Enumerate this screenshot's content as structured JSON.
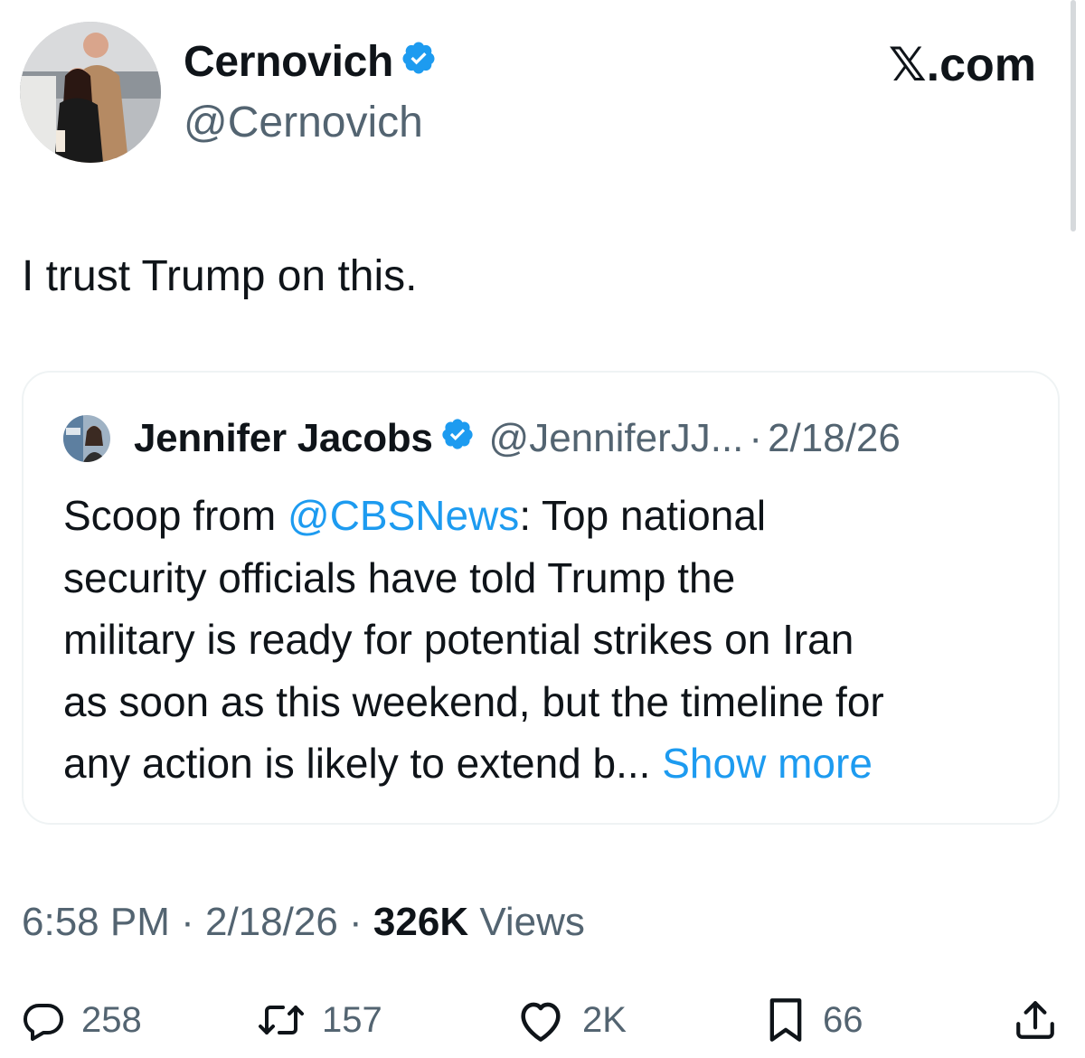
{
  "author": {
    "name": "Cernovich",
    "handle": "@Cernovich",
    "verified": true
  },
  "site": "𝕏.com",
  "tweet": {
    "text": "I trust Trump on this."
  },
  "quoted": {
    "name": "Jennifer Jacobs",
    "handle": "@JenniferJJ...",
    "separator": "·",
    "date": "2/18/26",
    "lines": [
      {
        "pre": "Scoop from ",
        "mention": "@CBSNews",
        "post": ": Top national"
      },
      "security officials have told Trump the",
      "military is ready for potential strikes on Iran",
      "as soon as this weekend, but the timeline for",
      {
        "pre": "any action is likely to extend b...",
        "link": " Show more"
      }
    ]
  },
  "meta": {
    "time": "6:58 PM",
    "sep": " · ",
    "date": "2/18/26",
    "views_count": "326K",
    "views_label": " Views"
  },
  "actions": {
    "replies": "258",
    "reposts": "157",
    "likes": "2K",
    "bookmarks": "66"
  },
  "colors": {
    "accent": "#1d9bf0",
    "secondary_text": "#536471",
    "primary_text": "#0f1419"
  }
}
